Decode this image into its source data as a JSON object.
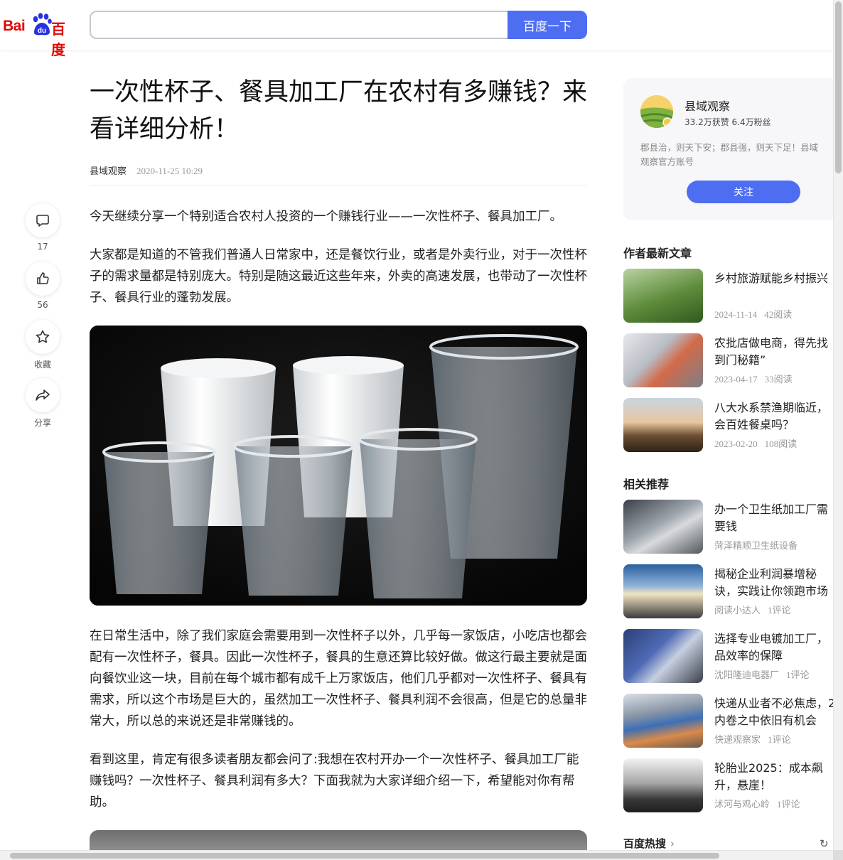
{
  "header": {
    "logo_latin": "Bai",
    "logo_paw": "du",
    "logo_cn": "百度",
    "search_value": "",
    "search_button": "百度一下"
  },
  "article": {
    "title": "一次性杯子、餐具加工厂在农村有多赚钱？来看详细分析！",
    "author": "县域观察",
    "date": "2020-11-25 10:29",
    "paragraphs": [
      "今天继续分享一个特别适合农村人投资的一个赚钱行业——一次性杯子、餐具加工厂。",
      "大家都是知道的不管我们普通人日常家中，还是餐饮行业，或者是外卖行业，对于一次性杯子的需求量都是特别庞大。特别是随这最近这些年来，外卖的高速发展，也带动了一次性杯子、餐具行业的蓬勃发展。",
      "在日常生活中，除了我们家庭会需要用到一次性杯子以外，几乎每一家饭店，小吃店也都会配有一次性杯子，餐具。因此一次性杯子，餐具的生意还算比较好做。做这行最主要就是面向餐饮业这一块，目前在每个城市都有成千上万家饭店，他们几乎都对一次性杯子、餐具有需求，所以这个市场是巨大的，虽然加工一次性杯子、餐具利润不会很高，但是它的总量非常大，所以总的来说还是非常赚钱的。",
      "看到这里，肯定有很多读者朋友都会问了:我想在农村开办一个一次性杯子、餐具加工厂能赚钱吗？一次性杯子、餐具利润有多大？下面我就为大家详细介绍一下，希望能对你有帮助。"
    ]
  },
  "actions": {
    "comment": {
      "icon": "comment-icon",
      "label": "17"
    },
    "like": {
      "icon": "thumbs-up-icon",
      "label": "56"
    },
    "favorite": {
      "icon": "star-icon",
      "label": "收藏"
    },
    "share": {
      "icon": "share-icon",
      "label": "分享"
    }
  },
  "author_card": {
    "name": "县域观察",
    "stats": "33.2万获赞 6.4万粉丝",
    "bio": "郡县治，则天下安；郡县强，则天下足！县域观察官方账号",
    "follow": "关注"
  },
  "latest": {
    "title": "作者最新文章",
    "items": [
      {
        "title": "乡村旅游赋能乡村振兴",
        "date": "2024-11-14",
        "reads": "42阅读"
      },
      {
        "title": "农批店做电商，得先找到门秘籍”",
        "date": "2023-04-17",
        "reads": "33阅读"
      },
      {
        "title": "八大水系禁渔期临近，会百姓餐桌吗？",
        "date": "2023-02-20",
        "reads": "108阅读"
      }
    ]
  },
  "related": {
    "title": "相关推荐",
    "items": [
      {
        "title": "办一个卫生纸加工厂需要钱",
        "source": "菏泽精顺卫生纸设备",
        "extra": ""
      },
      {
        "title": "揭秘企业利润暴增秘诀，实践让你领跑市场",
        "source": "阅读小达人",
        "extra": "1评论"
      },
      {
        "title": "选择专业电镀加工厂，品效率的保障",
        "source": "沈阳隆迪电器厂",
        "extra": "1评论"
      },
      {
        "title": "快递从业者不必焦虑，2内卷之中依旧有机会",
        "source": "快递观察家",
        "extra": "1评论"
      },
      {
        "title": "轮胎业2025：成本飙升，悬崖！",
        "source": "沭河与鸡心岭",
        "extra": "1评论"
      }
    ]
  },
  "hot": {
    "title": "百度热搜",
    "chevron": "›",
    "refresh": "↻"
  },
  "colors": {
    "accent": "#4e6ef2",
    "logo_red": "#e10602"
  }
}
